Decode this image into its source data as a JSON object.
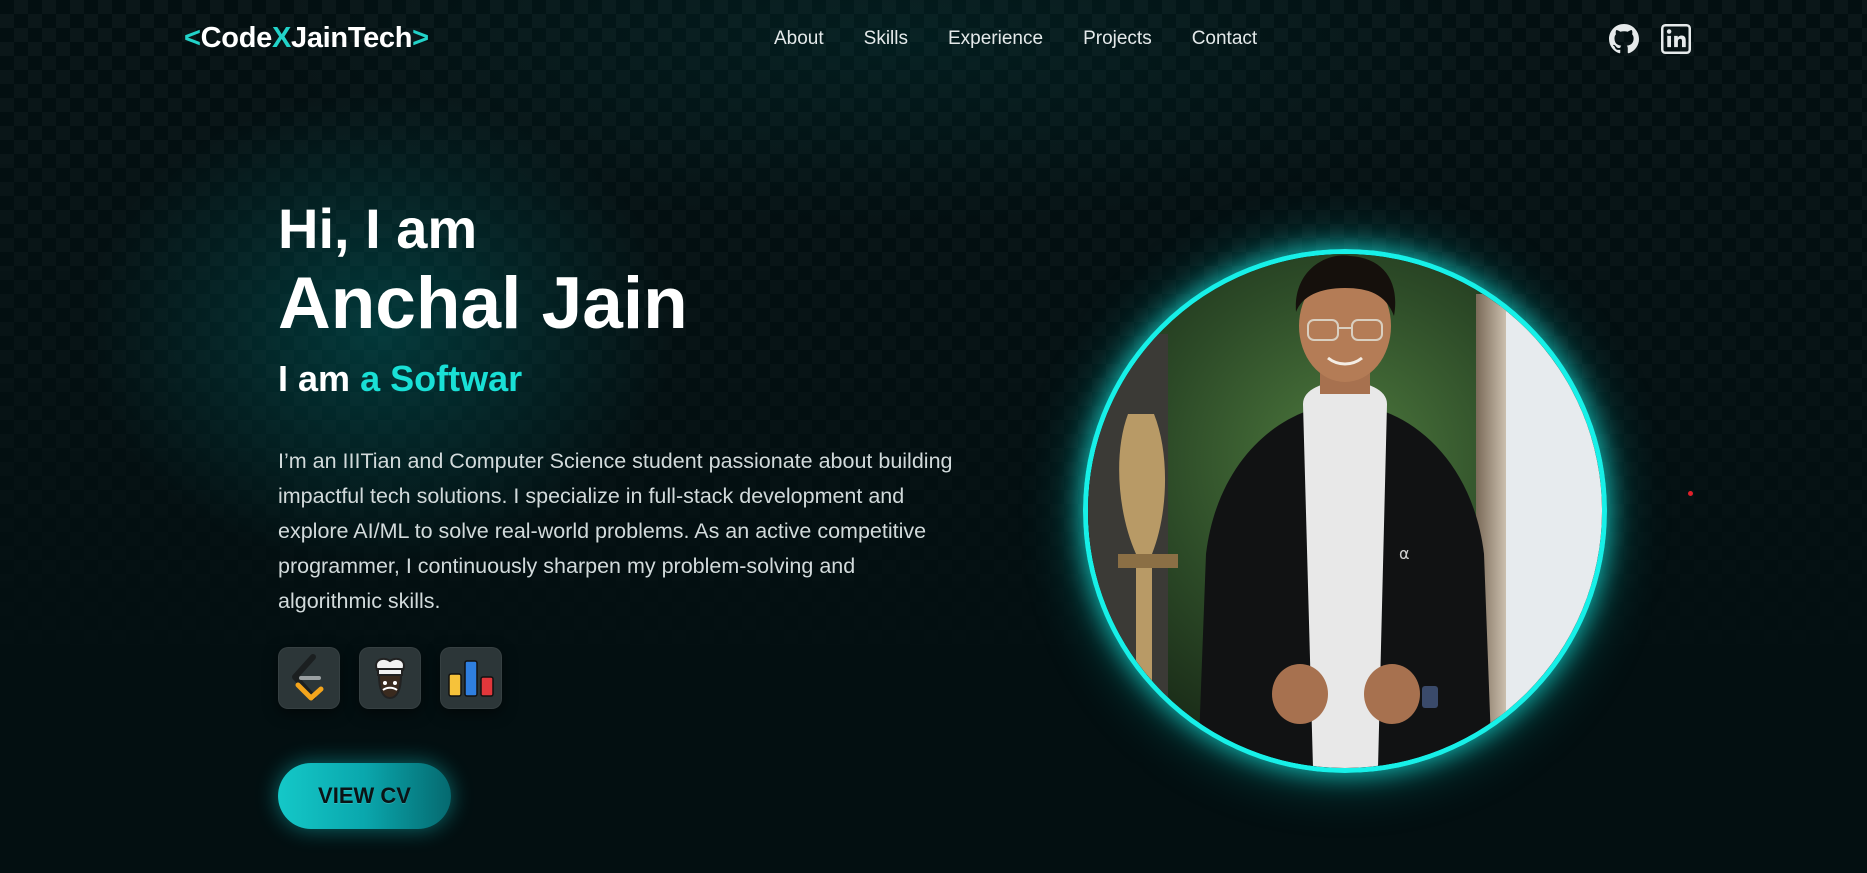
{
  "header": {
    "logo": {
      "lt": "<",
      "code": "Code",
      "x": "X",
      "jain": "JainTech",
      "gt": ">"
    },
    "nav": [
      "About",
      "Skills",
      "Experience",
      "Projects",
      "Contact"
    ],
    "social_icons": [
      "github-icon",
      "linkedin-icon"
    ]
  },
  "hero": {
    "greeting": "Hi, I am",
    "name": "Anchal Jain",
    "role_prefix": "I am",
    "role_typed": "a Softwar",
    "bio": "I’m an IIITian and Computer Science student passionate about building impactful tech solutions. I specialize in full-stack development and explore AI/ML to solve real-world problems. As an active competitive programmer, I continuously sharpen my problem-solving and algorithmic skills.",
    "profile_icons": [
      "leetcode-icon",
      "codechef-icon",
      "codeforces-icon"
    ],
    "cv_button": "VIEW CV"
  },
  "colors": {
    "accent": "#19e0d6",
    "background": "#030f11",
    "photo_ring": "#17f0e8"
  }
}
